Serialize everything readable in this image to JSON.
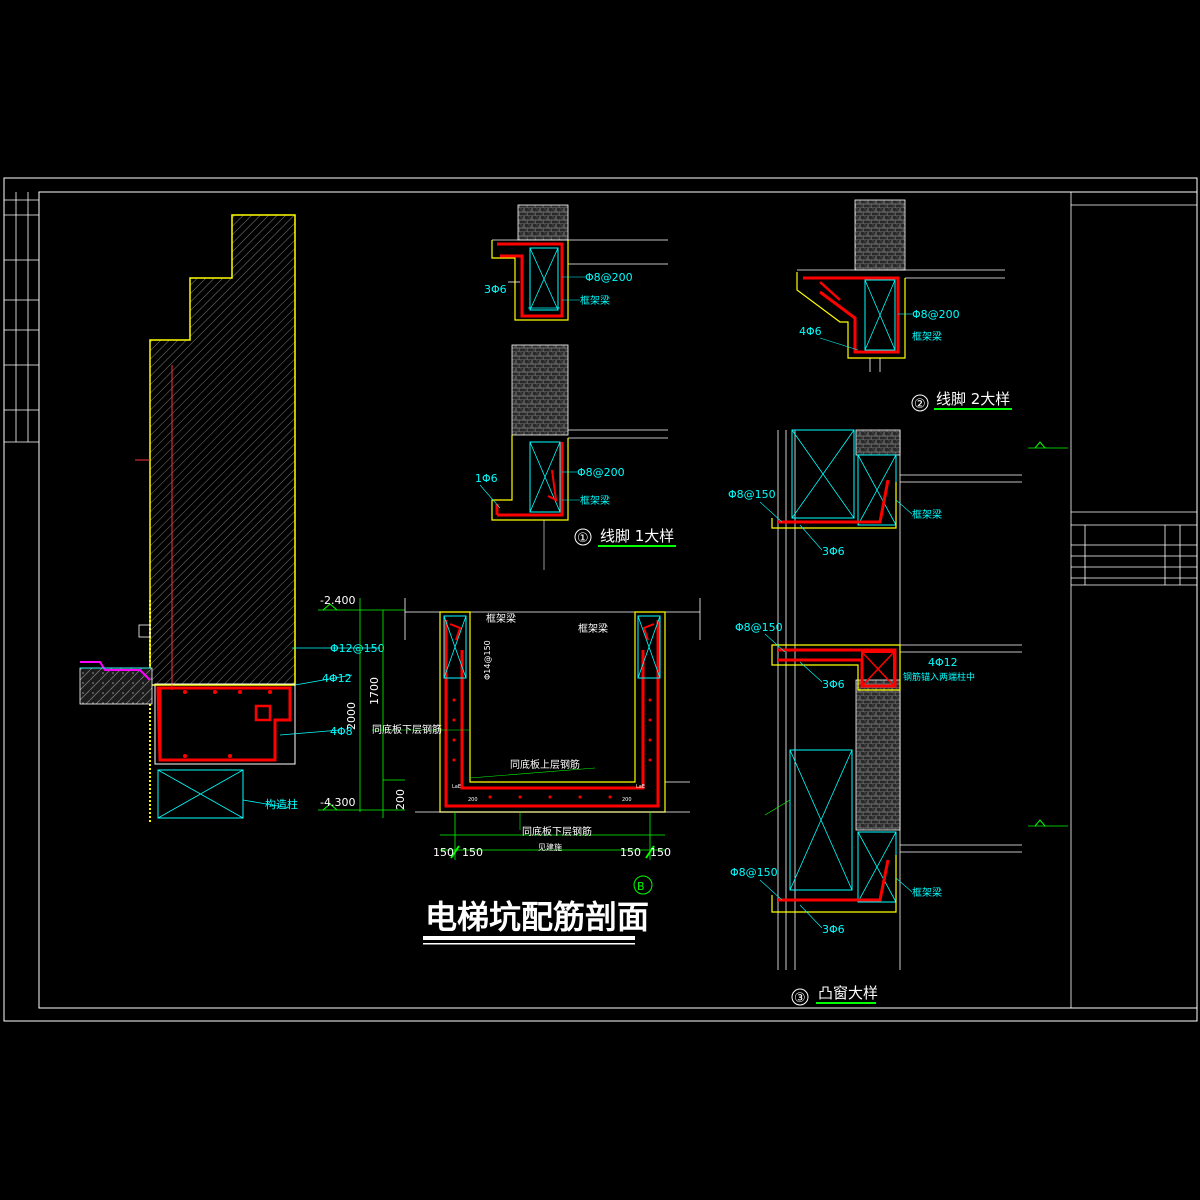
{
  "main_title": "电梯坑配筋剖面",
  "axis_marker": "B",
  "details": {
    "d1": {
      "number": "①",
      "title": "线脚 1大样"
    },
    "d2": {
      "number": "②",
      "title": "线脚 2大样"
    },
    "d3": {
      "number": "③",
      "title": "凸窗大样"
    }
  },
  "labels": {
    "rebar_3phi6": "3Φ6",
    "rebar_phi8_200": "Φ8@200",
    "frame_beam": "框架梁",
    "rebar_1phi6": "1Φ6",
    "rebar_4phi6": "4Φ6",
    "rebar_phi8_150": "Φ8@150",
    "rebar_4phi12": "4Φ12",
    "rebar_anchor_note": "钢筋锚入两端柱中",
    "rebar_phi12_150": "Φ12@150",
    "rebar_4phi8": "4Φ8",
    "structural_column": "构造柱",
    "same_bottom_lower": "同底板下层钢筋",
    "same_bottom_upper": "同底板上层钢筋",
    "same_bottom_lower_2": "同底板下层钢筋",
    "wall_rebar": "Φ14@150",
    "pit_bottom": "见建施",
    "lae_left": "LaE",
    "lae_right": "LaE"
  },
  "dimensions": {
    "elev_top": "-2.400",
    "elev_bottom": "-4.300",
    "dim_2000": "2000",
    "dim_1700": "1700",
    "dim_200": "200",
    "dim_150_a": "150",
    "dim_150_b": "150",
    "dim_150_c": "150",
    "dim_150_d": "150",
    "dim_200_l": "200",
    "dim_200_r": "200"
  },
  "colors": {
    "background": "#000000",
    "frame": "#ffffff",
    "rebar": "#ff0000",
    "concrete_outline": "#ffff00",
    "annotation": "#00ffff",
    "dimension": "#00ff00",
    "hatch": "#808080"
  }
}
